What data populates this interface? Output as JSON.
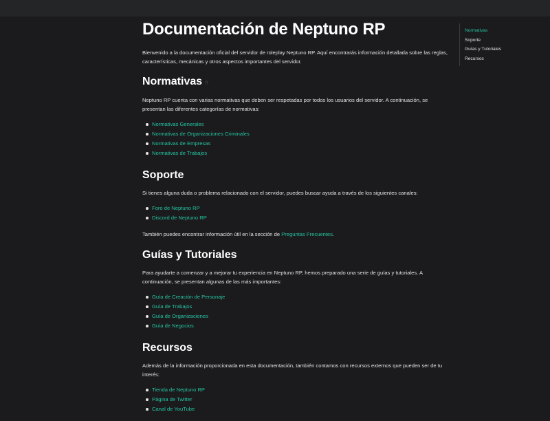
{
  "page": {
    "title": "Documentación de Neptuno RP",
    "intro": "Bienvenido a la documentación oficial del servidor de roleplay Neptuno RP. Aquí encontrarás información detallada sobre las reglas, características, mecánicas y otros aspectos importantes del servidor."
  },
  "sections": {
    "normativas": {
      "heading": "Normativas",
      "anchor": "#",
      "text": "Neptuno RP cuenta con varias normativas que deben ser respetadas por todos los usuarios del servidor. A continuación, se presentan las diferentes categorías de normativas:",
      "links": [
        "Normativas Generales",
        "Normativas de Organizaciones Criminales",
        "Normativas de Empresas",
        "Normativas de Trabajos"
      ]
    },
    "soporte": {
      "heading": "Soporte",
      "text": "Si tienes alguna duda o problema relacionado con el servidor, puedes buscar ayuda a través de los siguientes canales:",
      "links": [
        "Foro de Neptuno RP",
        "Discord de Neptuno RP"
      ],
      "extra_prefix": "También puedes encontrar información útil en la sección de ",
      "extra_link": "Preguntas Frecuentes",
      "extra_suffix": "."
    },
    "guias": {
      "heading": "Guías y Tutoriales",
      "text": "Para ayudarte a comenzar y a mejorar tu experiencia en Neptuno RP, hemos preparado una serie de guías y tutoriales. A continuación, se presentan algunas de las más importantes:",
      "links": [
        "Guía de Creación de Personaje",
        "Guía de Trabajos",
        "Guía de Organizaciones",
        "Guía de Negocios"
      ]
    },
    "recursos": {
      "heading": "Recursos",
      "text": "Además de la información proporcionada en esta documentación, también contamos con recursos externos que pueden ser de tu interés:",
      "links": [
        "Tienda de Neptuno RP",
        "Página de Twitter",
        "Canal de YouTube"
      ]
    }
  },
  "toc": {
    "items": [
      "Normativas",
      "Soporte",
      "Guías y Tutoriales",
      "Recursos"
    ],
    "active_index": 0
  },
  "colors": {
    "accent": "#25c2a0",
    "background": "#1b1b1d",
    "topbar": "#242526"
  }
}
